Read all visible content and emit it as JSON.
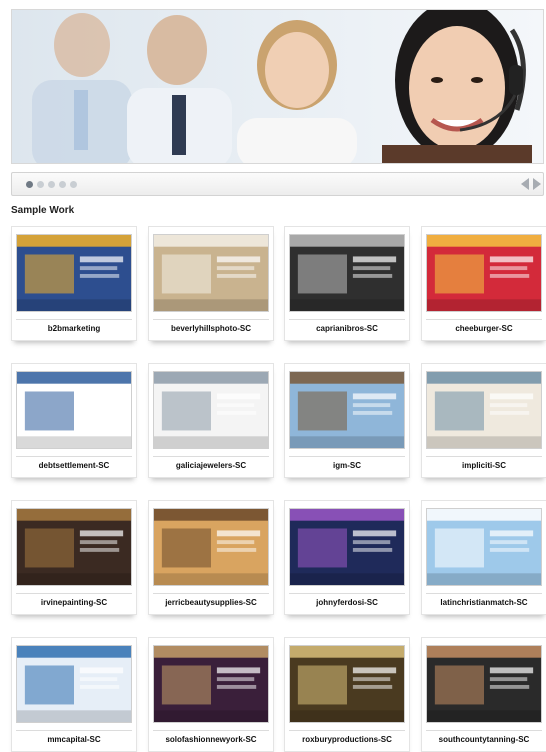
{
  "slider": {
    "dots": 5,
    "active_index": 0
  },
  "section": {
    "title": "Sample Work"
  },
  "works": [
    {
      "label": "b2bmarketing",
      "bg": "#2d4e8f",
      "accent": "#f2b12a"
    },
    {
      "label": "beverlyhillsphoto-SC",
      "bg": "#c9b38f",
      "accent": "#f3efe6"
    },
    {
      "label": "caprianibros-SC",
      "bg": "#2f2f2f",
      "accent": "#bdbdbd"
    },
    {
      "label": "cheeburger-SC",
      "bg": "#d32a3a",
      "accent": "#f4c542"
    },
    {
      "label": "debtsettlement-SC",
      "bg": "#ffffff",
      "accent": "#2e5d9c"
    },
    {
      "label": "galiciajewelers-SC",
      "bg": "#f4f4f4",
      "accent": "#8c9aa8"
    },
    {
      "label": "igm-SC",
      "bg": "#8fb6d9",
      "accent": "#7a5b3b"
    },
    {
      "label": "impliciti-SC",
      "bg": "#efe9de",
      "accent": "#6f8fa6"
    },
    {
      "label": "irvinepainting-SC",
      "bg": "#3b2a22",
      "accent": "#a6793f"
    },
    {
      "label": "jerricbeautysupplies-SC",
      "bg": "#d9a460",
      "accent": "#6b4a2b"
    },
    {
      "label": "johnyferdosi-SC",
      "bg": "#1f2a5a",
      "accent": "#9b57c7"
    },
    {
      "label": "latinchristianmatch-SC",
      "bg": "#9ec9ea",
      "accent": "#ffffff"
    },
    {
      "label": "mmcapital-SC",
      "bg": "#e6eef7",
      "accent": "#2e6fb0"
    },
    {
      "label": "solofashionnewyork-SC",
      "bg": "#3a1f3a",
      "accent": "#c7a06a"
    },
    {
      "label": "roxburyproductions-SC",
      "bg": "#4a3a20",
      "accent": "#d9bf7a"
    },
    {
      "label": "southcountytanning-SC",
      "bg": "#2a2a2a",
      "accent": "#c58e63"
    }
  ]
}
